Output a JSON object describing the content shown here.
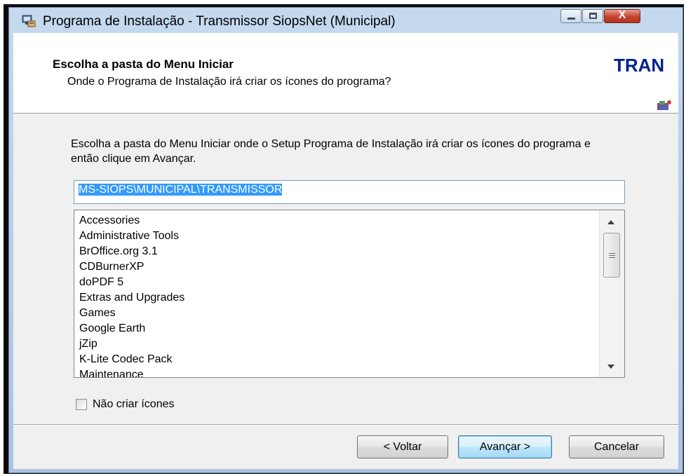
{
  "window": {
    "title": "Programa de Instalação - Transmissor SiopsNet (Municipal)",
    "controls": {
      "close_glyph": "X"
    },
    "icon": "installer-computer-icon"
  },
  "header": {
    "title": "Escolha a pasta do Menu Iniciar",
    "subtitle": "Onde o Programa de Instalação irá criar os ícones do programa?",
    "brand_text": "TRAN",
    "brand_icon": "transmitter-logo-icon"
  },
  "main": {
    "instructions": "Escolha a pasta do Menu Iniciar onde o Setup Programa de Instalação irá criar os ícones do programa e então clique em Avançar.",
    "folder_path": "MS-SIOPS\\MUNICIPAL\\TRANSMISSOR",
    "folder_list": [
      "Accessories",
      "Administrative Tools",
      "BrOffice.org 3.1",
      "CDBurnerXP",
      "doPDF 5",
      "Extras and Upgrades",
      "Games",
      "Google Earth",
      "jZip",
      "K-Lite Codec Pack",
      "Maintenance"
    ],
    "no_icons_checkbox": {
      "label": "Não criar ícones",
      "checked": false
    }
  },
  "buttons": {
    "back": "< Voltar",
    "next": "Avançar >",
    "cancel": "Cancelar"
  },
  "colors": {
    "brand": "#00228b",
    "selection": "#3399ff",
    "close_button": "#c4432c"
  }
}
